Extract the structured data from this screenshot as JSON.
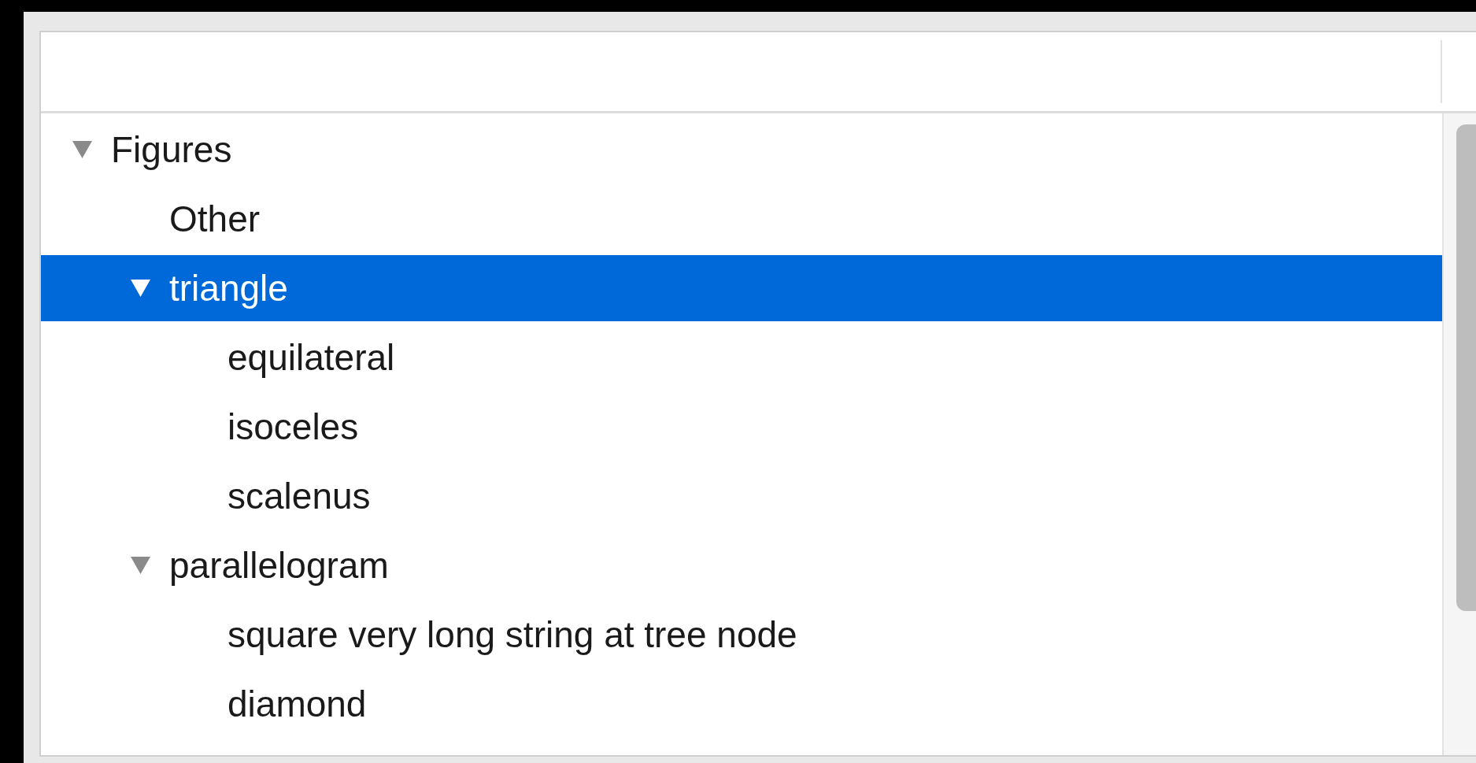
{
  "tree": {
    "items": [
      {
        "label": "Figures",
        "selected": false,
        "expanded": true,
        "children": [
          {
            "label": "Other",
            "selected": false
          },
          {
            "label": "triangle",
            "selected": true,
            "expanded": true,
            "children": [
              {
                "label": "equilateral",
                "selected": false
              },
              {
                "label": "isoceles",
                "selected": false
              },
              {
                "label": "scalenus",
                "selected": false
              }
            ]
          },
          {
            "label": "parallelogram",
            "selected": false,
            "expanded": true,
            "children": [
              {
                "label": "square very long string at tree node",
                "selected": false
              },
              {
                "label": "diamond",
                "selected": false
              }
            ]
          }
        ]
      }
    ]
  }
}
